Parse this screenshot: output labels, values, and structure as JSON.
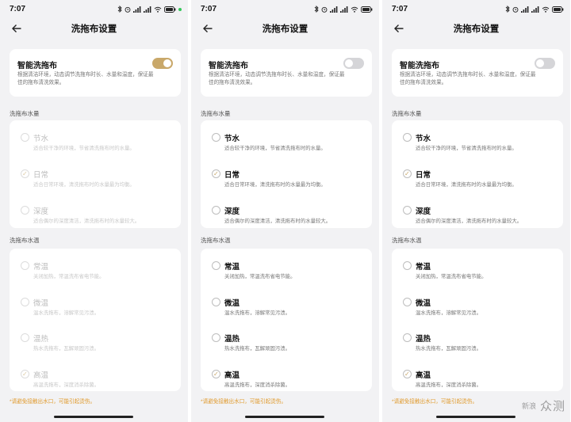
{
  "screens": [
    {
      "status_time": "7:07",
      "title": "洗拖布设置",
      "smart": {
        "title": "智能洗拖布",
        "desc": "根据清洁环境，动态调节洗拖布时长、水量和温度，保证最佳的拖布清洗效果。",
        "on": true
      },
      "water_label": "洗拖布水量",
      "water": [
        {
          "title": "节水",
          "desc": "适合较干净的环境，节省清洗拖布时的水量。",
          "checked": false
        },
        {
          "title": "日常",
          "desc": "适合日常环境，清洗拖布时的水量最为均衡。",
          "checked": true
        },
        {
          "title": "深度",
          "desc": "适合偶尔的深度清洁，清洗拖布时的水量较大。",
          "checked": false
        }
      ],
      "temp_label": "洗拖布水温",
      "temp": [
        {
          "title": "常温",
          "desc": "关闭加热，常温洗布省电节能。",
          "checked": false
        },
        {
          "title": "微温",
          "desc": "温水洗拖布，溶解常见污渍。",
          "checked": false
        },
        {
          "title": "温热",
          "desc": "热水洗拖布，瓦解顽固污渍。",
          "checked": false
        },
        {
          "title": "高温",
          "desc": "高温洗拖布，深度消杀除菌。",
          "checked": true
        }
      ],
      "footnote": "*请避免接触出水口，可能引起烫伤。"
    },
    {
      "status_time": "7:07",
      "title": "洗拖布设置",
      "smart": {
        "title": "智能洗拖布",
        "desc": "根据清洁环境，动态调节洗拖布时长、水量和温度，保证最佳的拖布清洗效果。",
        "on": false
      },
      "water_label": "洗拖布水量",
      "water": [
        {
          "title": "节水",
          "desc": "适合较干净的环境，节省清洗拖布时的水量。",
          "checked": false
        },
        {
          "title": "日常",
          "desc": "适合日常环境，清洗拖布时的水量最为均衡。",
          "checked": true
        },
        {
          "title": "深度",
          "desc": "适合偶尔的深度清洁，清洗拖布时的水量较大。",
          "checked": false
        }
      ],
      "temp_label": "洗拖布水温",
      "temp": [
        {
          "title": "常温",
          "desc": "关闭加热，常温洗布省电节能。",
          "checked": false
        },
        {
          "title": "微温",
          "desc": "温水洗拖布，溶解常见污渍。",
          "checked": false
        },
        {
          "title": "温热",
          "desc": "热水洗拖布，瓦解顽固污渍。",
          "checked": false
        },
        {
          "title": "高温",
          "desc": "高温洗拖布，深度消杀除菌。",
          "checked": true
        }
      ],
      "footnote": "*请避免接触出水口，可能引起烫伤。"
    },
    {
      "status_time": "7:07",
      "title": "洗拖布设置",
      "smart": {
        "title": "智能洗拖布",
        "desc": "根据清洁环境，动态调节洗拖布时长、水量和温度，保证最佳的拖布清洗效果。",
        "on": false
      },
      "water_label": "洗拖布水量",
      "water": [
        {
          "title": "节水",
          "desc": "适合较干净的环境，节省清洗拖布时的水量。",
          "checked": false
        },
        {
          "title": "日常",
          "desc": "适合日常环境，清洗拖布时的水量最为均衡。",
          "checked": true
        },
        {
          "title": "深度",
          "desc": "适合偶尔的深度清洁，清洗拖布时的水量较大。",
          "checked": false
        }
      ],
      "temp_label": "洗拖布水温",
      "temp": [
        {
          "title": "常温",
          "desc": "关闭加热，常温洗布省电节能。",
          "checked": false
        },
        {
          "title": "微温",
          "desc": "温水洗拖布，溶解常见污渍。",
          "checked": false
        },
        {
          "title": "温热",
          "desc": "热水洗拖布，瓦解顽固污渍。",
          "checked": false
        },
        {
          "title": "高温",
          "desc": "高温洗拖布，深度消杀除菌。",
          "checked": true
        }
      ],
      "footnote": "*请避免接触出水口，可能引起烫伤。"
    }
  ],
  "watermark": {
    "mark": "新浪",
    "text": "众测"
  },
  "icons": {
    "back": "arrow-left-icon",
    "check": "checkmark-icon"
  },
  "colors": {
    "accent": "#c9a86a",
    "warning": "#e09a2c",
    "background": "#f2f2f4"
  }
}
